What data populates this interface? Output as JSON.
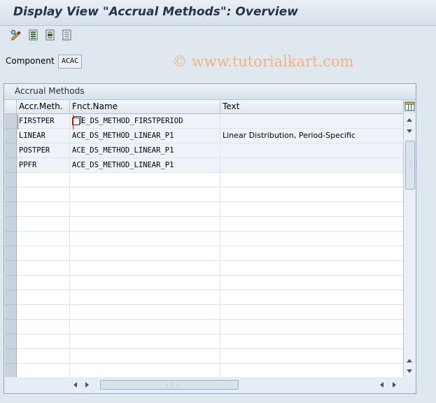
{
  "window": {
    "title": "Display View \"Accrual Methods\": Overview"
  },
  "toolbar": {
    "buttons": [
      {
        "name": "display-change-icon"
      },
      {
        "name": "select-all-icon"
      },
      {
        "name": "select-block-icon"
      },
      {
        "name": "deselect-all-icon"
      }
    ]
  },
  "watermark": "© www.tutorialkart.com",
  "component": {
    "label": "Component",
    "value": "ACAC"
  },
  "table": {
    "title": "Accrual Methods",
    "columns": [
      "Accr.Meth.",
      "Fnct.Name",
      "Text"
    ],
    "rows": [
      {
        "method": "FIRSTPER",
        "fnct": "ACE_DS_METHOD_FIRSTPERIOD",
        "fnct_shown": "E_DS_METHOD_FIRSTPERIOD",
        "text": ""
      },
      {
        "method": "LINEAR",
        "fnct": "ACE_DS_METHOD_LINEAR_P1",
        "fnct_shown": "ACE_DS_METHOD_LINEAR_P1",
        "text": "Linear Distribution, Period-Specific"
      },
      {
        "method": "POSTPER",
        "fnct": "ACE_DS_METHOD_LINEAR_P1",
        "fnct_shown": "ACE_DS_METHOD_LINEAR_P1",
        "text": ""
      },
      {
        "method": "PPFR",
        "fnct": "ACE_DS_METHOD_LINEAR_P1",
        "fnct_shown": "ACE_DS_METHOD_LINEAR_P1",
        "text": ""
      }
    ],
    "empty_rows": 14
  },
  "colors": {
    "background": "#dfe7ef",
    "title_text": "#25334a",
    "cursor": "#d9352e",
    "watermark": "#efb28a"
  }
}
